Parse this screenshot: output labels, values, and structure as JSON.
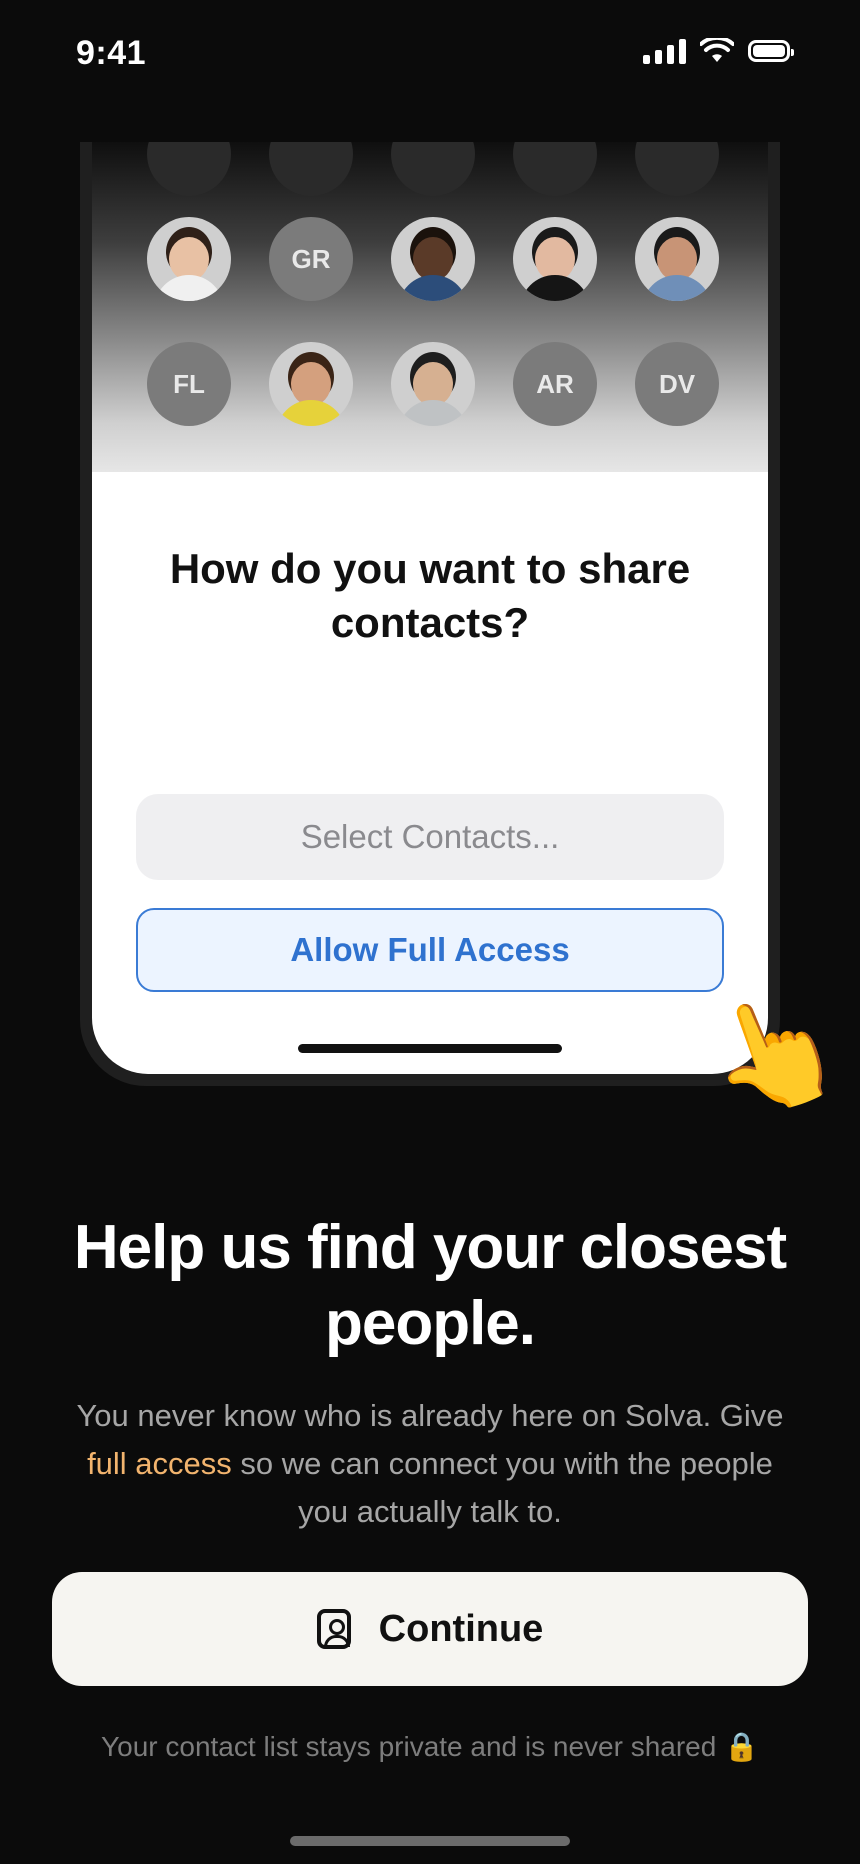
{
  "status_bar": {
    "time": "9:41"
  },
  "contacts": {
    "rows": [
      [
        {
          "kind": "photo",
          "name": "woman-avatar-1",
          "skin": "#e8c1a4",
          "hair": "#2f2018",
          "shirt": "#f0f0f0"
        },
        {
          "kind": "initials",
          "initials": "GR"
        },
        {
          "kind": "photo",
          "name": "man-avatar-1",
          "skin": "#5a3a28",
          "hair": "#1b120c",
          "shirt": "#2c4d7a"
        },
        {
          "kind": "photo",
          "name": "woman-avatar-2",
          "skin": "#e2b9a0",
          "hair": "#1a1a1a",
          "shirt": "#151515"
        },
        {
          "kind": "photo",
          "name": "man-avatar-2",
          "skin": "#c89476",
          "hair": "#1a1a1a",
          "shirt": "#6f8fb8"
        }
      ],
      [
        {
          "kind": "initials",
          "initials": "FL"
        },
        {
          "kind": "photo",
          "name": "woman-avatar-3",
          "skin": "#d4a07e",
          "hair": "#3a2416",
          "shirt": "#e6d23a"
        },
        {
          "kind": "photo",
          "name": "man-avatar-3",
          "skin": "#d6b091",
          "hair": "#1e1e1e",
          "shirt": "#bfc2c4"
        },
        {
          "kind": "initials",
          "initials": "AR"
        },
        {
          "kind": "initials",
          "initials": "DV"
        }
      ]
    ]
  },
  "sheet": {
    "title": "How do you want to share contacts?",
    "select_label": "Select Contacts...",
    "allow_label": "Allow Full Access"
  },
  "hand_emoji": "👆",
  "headline": "Help us find your closest people.",
  "subtext": {
    "part1": "You never know who is already here on Solva. Give ",
    "accent": "full access",
    "part2": " so we can connect you with the people you actually talk to."
  },
  "continue_label": "Continue",
  "privacy_note": "Your contact list stays private and is never shared 🔒",
  "icons": {
    "signal": "cellular-signal-icon",
    "wifi": "wifi-icon",
    "battery": "battery-icon",
    "contact": "contact-card-icon"
  },
  "colors": {
    "accent": "#f2b46e",
    "link_blue": "#2f72cf",
    "background": "#0b0b0b"
  }
}
